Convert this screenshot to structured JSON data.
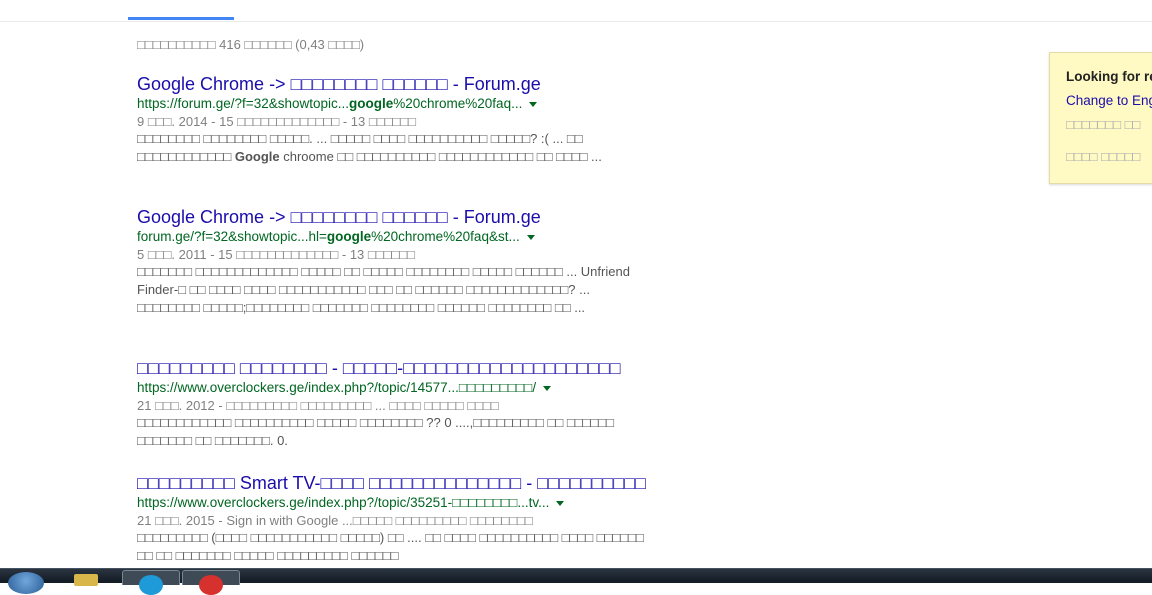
{
  "stats": "□□□□□□□□□□ 416 □□□□□□ (0,43 □□□□)",
  "results": [
    {
      "title": "Google Chrome -> □□□□□□□□ □□□□□□ - Forum.ge",
      "url_pre": "https://forum.ge/?f=32&showtopic...",
      "url_bold": "google",
      "url_post": "%20chrome%20faq...",
      "meta": "9 □□□. 2014 - 15 □□□□□□□□□□□□□ - 13 □□□□□□",
      "snippet_1": "□□□□□□□□ □□□□□□□□ □□□□□. ... □□□□□ □□□□ □□□□□□□□□□ □□□□□? :( ... □□ □□□□□□□□□□□□ ",
      "snippet_bold": "Google",
      "snippet_2": " chroome □□ □□□□□□□□□□ □□□□□□□□□□□□ □□ □□□□ ..."
    },
    {
      "title": "Google Chrome -> □□□□□□□□ □□□□□□ - Forum.ge",
      "url_pre": "forum.ge/?f=32&showtopic...hl=",
      "url_bold": "google",
      "url_post": "%20chrome%20faq&st...",
      "meta": "5 □□□. 2011 - 15 □□□□□□□□□□□□□ - 13 □□□□□□",
      "snippet_1": "□□□□□□□ □□□□□□□□□□□□□ □□□□□ □□ □□□□□ □□□□□□□□ □□□□□ □□□□□□ ... Unfriend Finder-□ □□ □□□□ □□□□ □□□□□□□□□□□ □□□ □□ □□□□□□ □□□□□□□□□□□□□? ... □□□□□□□□ □□□□□;□□□□□□□□ □□□□□□□ □□□□□□□□ □□□□□□ □□□□□□□□ □□ ...",
      "snippet_bold": "",
      "snippet_2": ""
    },
    {
      "title": "□□□□□□□□□ □□□□□□□□ - □□□□□-□□□□□□□□□□□□□□□□□□□□",
      "url_pre": "https://www.overclockers.ge/index.php?/topic/14577...□□□□□□□□□/",
      "url_bold": "",
      "url_post": "",
      "meta": "21 □□□. 2012 - □□□□□□□□□ □□□□□□□□□ ... □□□□ □□□□□ □□□□",
      "snippet_1": "□□□□□□□□□□□□ □□□□□□□□□□ □□□□□ □□□□□□□□ ?? 0 ....,□□□□□□□□□ □□ □□□□□□ □□□□□□□ □□ □□□□□□□. 0.",
      "snippet_bold": "",
      "snippet_2": ""
    },
    {
      "title": "□□□□□□□□□ Smart TV-□□□□ □□□□□□□□□□□□□□ - □□□□□□□□□□",
      "url_pre": "https://www.overclockers.ge/index.php?/topic/35251-□□□□□□□□...tv...",
      "url_bold": "",
      "url_post": "",
      "meta": "21 □□□. 2015 - Sign in with Google ...□□□□□ □□□□□□□□□ □□□□□□□□",
      "snippet_1": "□□□□□□□□□ (□□□□ □□□□□□□□□□□ □□□□□) □□ .... □□ □□□□ □□□□□□□□□□ □□□□ □□□□□□ □□ □□ □□□□□□□ □□□□□ □□□□□□□□□ □□□□□□",
      "snippet_bold": "",
      "snippet_2": ""
    }
  ],
  "notice": {
    "title": "Looking for re",
    "link": "Change to Eng",
    "line1": "□□□□□□□ □□",
    "line2": "□□□□ □□□□□"
  },
  "taskbar": {
    "icons": [
      "windows-start-icon",
      "file-explorer-icon",
      "skype-icon",
      "opera-icon"
    ]
  }
}
